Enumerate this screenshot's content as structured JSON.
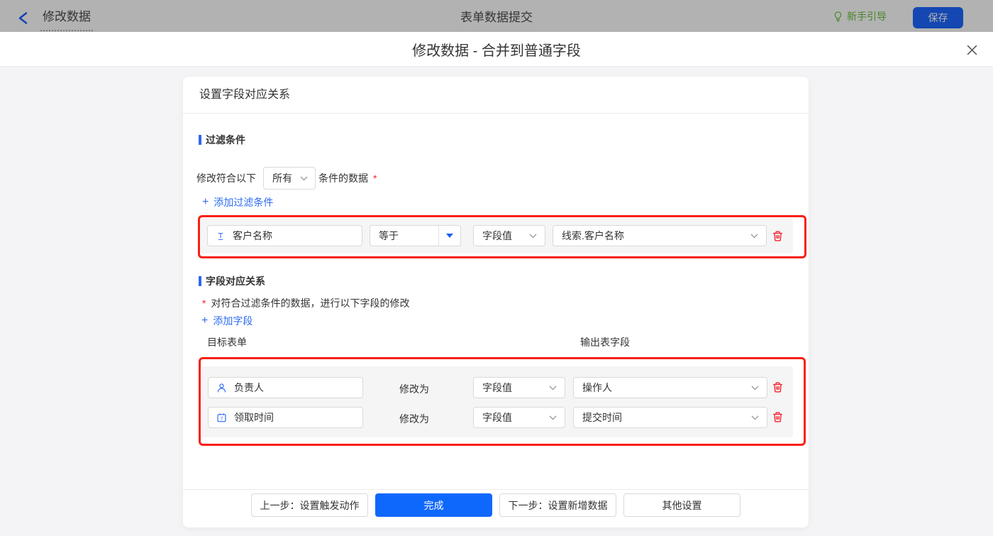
{
  "colors": {
    "accent_blue": "#0f68fc",
    "link_blue": "#2e6bf2",
    "field_icon_blue": "#3b72f8",
    "annotation_red": "#fa1f14",
    "danger_red": "#f5222d",
    "guide_green": "#67c23a",
    "topbar_save_blue": "#1d66ff"
  },
  "topbar": {
    "title": "修改数据",
    "center_title": "表单数据提交",
    "guide_label": "新手引导",
    "save_label": "保存"
  },
  "modal": {
    "title": "修改数据 - 合并到普通字段"
  },
  "card": {
    "header": "设置字段对应关系",
    "filter_section": {
      "title": "过滤条件",
      "condition_prefix": "修改符合以下",
      "condition_select_value": "所有",
      "condition_suffix": "条件的数据",
      "required_mark": "*",
      "plus_icon": "+",
      "add_link": "添加过滤条件",
      "row": {
        "field": "客户名称",
        "operator": "等于",
        "value_type": "字段值",
        "value": "线索.客户名称"
      }
    },
    "mapping_section": {
      "title": "字段对应关系",
      "required_mark": "*",
      "description": "对符合过滤条件的数据，进行以下字段的修改",
      "plus_icon": "+",
      "add_link": "添加字段",
      "col_left": "目标表单",
      "col_right": "输出表字段",
      "rows": [
        {
          "field": "负责人",
          "modify_label": "修改为",
          "value_type": "字段值",
          "value": "操作人"
        },
        {
          "field": "领取时间",
          "modify_label": "修改为",
          "value_type": "字段值",
          "value": "提交时间"
        }
      ]
    },
    "footer": {
      "prev_label": "上一步：设置触发动作",
      "done_label": "完成",
      "next_label": "下一步：设置新增数据",
      "other_label": "其他设置"
    }
  }
}
